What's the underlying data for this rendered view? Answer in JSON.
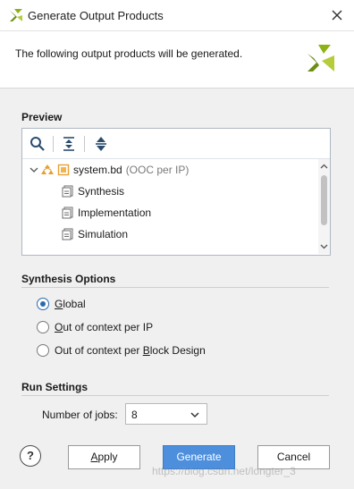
{
  "window": {
    "title": "Generate Output Products",
    "close_icon": "close-icon"
  },
  "header": {
    "description": "The following output products will be generated."
  },
  "preview": {
    "title": "Preview",
    "toolbar": {
      "search_icon": "search-icon",
      "collapse_all_icon": "collapse-all-icon",
      "expand_all_icon": "expand-all-icon"
    },
    "root": {
      "name": "system.bd",
      "suffix": "(OOC per IP)"
    },
    "children": [
      "Synthesis",
      "Implementation",
      "Simulation"
    ]
  },
  "synthesis_options": {
    "title": "Synthesis Options",
    "options": [
      {
        "pre": "",
        "mnemonic": "G",
        "post": "lobal",
        "checked": true
      },
      {
        "pre": "",
        "mnemonic": "O",
        "post": "ut of context per IP",
        "checked": false
      },
      {
        "pre": "Out of context per ",
        "mnemonic": "B",
        "post": "lock Design",
        "checked": false
      }
    ]
  },
  "run_settings": {
    "title": "Run Settings",
    "jobs_label_pre": "Number of ",
    "jobs_label_mnemonic": "j",
    "jobs_label_post": "obs:",
    "jobs_value": "8"
  },
  "buttons": {
    "help": "?",
    "apply_mnemonic": "A",
    "apply_rest": "pply",
    "generate": "Generate",
    "cancel": "Cancel"
  },
  "watermark": "https://blog.csdn.net/longter_3",
  "colors": {
    "accent": "#4d8fdc",
    "radio_checked": "#2a6bb0",
    "logo": "#8cb312"
  }
}
